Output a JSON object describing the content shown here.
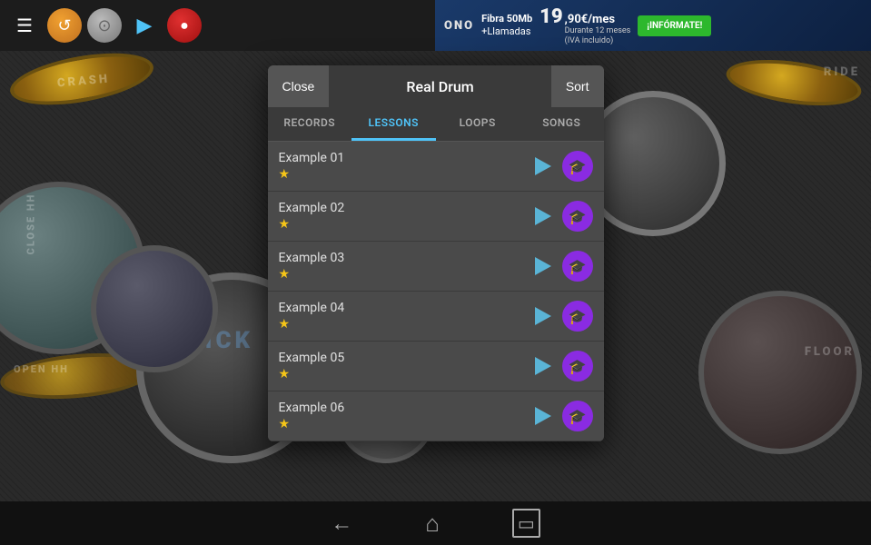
{
  "toolbar": {
    "menu_icon": "☰",
    "play_icon": "▶",
    "stop_color": "#e03030"
  },
  "ad": {
    "logo": "ONO",
    "line1": "Fibra 50Mb",
    "line2": "+Llamadas",
    "price": "19",
    "price_decimal": ",90€/mes",
    "price_sub1": "Durante 12 meses",
    "price_sub2": "(IVA incluido)",
    "cta": "¡INFÓRMATE!"
  },
  "modal": {
    "close_label": "Close",
    "title": "Real Drum",
    "sort_label": "Sort",
    "tabs": [
      {
        "id": "records",
        "label": "RECORDS",
        "active": false
      },
      {
        "id": "lessons",
        "label": "LESSONS",
        "active": true
      },
      {
        "id": "loops",
        "label": "LOOPS",
        "active": false
      },
      {
        "id": "songs",
        "label": "SONGS",
        "active": false
      }
    ],
    "lessons": [
      {
        "name": "Example 01",
        "stars": 1
      },
      {
        "name": "Example 02",
        "stars": 1
      },
      {
        "name": "Example 03",
        "stars": 1
      },
      {
        "name": "Example 04",
        "stars": 1
      },
      {
        "name": "Example 05",
        "stars": 1
      },
      {
        "name": "Example 06",
        "stars": 1
      }
    ]
  },
  "bottom_nav": {
    "back_icon": "←",
    "home_icon": "⌂",
    "recents_icon": "▭"
  },
  "drum_labels": {
    "crash": "CRASH",
    "ride": "RIDE",
    "close_hh": "CLOSE HH",
    "open_hh": "OPEN HH",
    "floor": "FLOOR",
    "kick": "KICK"
  }
}
